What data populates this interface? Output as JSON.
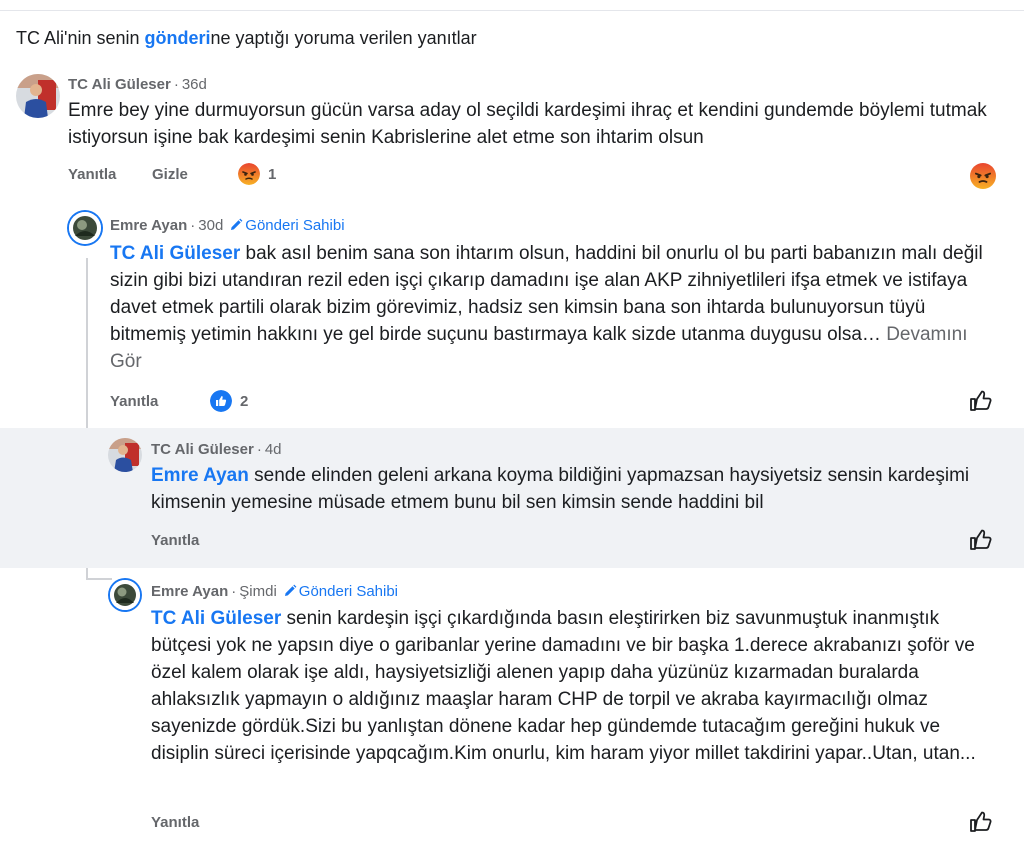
{
  "header": {
    "prefix": "TC Ali'nin senin ",
    "link": "gönderi",
    "suffix": "ne yaptığı yoruma verilen yanıtlar"
  },
  "comments": [
    {
      "author": "TC Ali Güleser",
      "time": "36d",
      "text": "Emre bey yine durmuyorsun gücün varsa aday ol seçildi kardeşimi ihraç et kendini gundemde böylemi tutmak istiyorsun işine bak kardeşimi senin Kabrislerine alet etme son ihtarim olsun",
      "reply_label": "Yanıtla",
      "hide_label": "Gizle",
      "reaction_count": "1"
    },
    {
      "author": "Emre Ayan",
      "time": "30d",
      "badge": "Gönderi Sahibi",
      "tag": "TC Ali Güleser",
      "text": " bak asıl benim sana son ihtarım olsun, haddini bil onurlu ol bu parti babanızın malı değil sizin gibi bizi utandıran rezil eden işçi çıkarıp damadını işe alan AKP zihniyetlileri ifşa etmek ve istifaya davet etmek partili olarak bizim görevimiz, hadsiz sen kimsin bana son ihtarda bulunuyorsun tüyü bitmemiş yetimin hakkını ye gel birde suçunu bastırmaya kalk sizde utanma duygusu olsa…",
      "more": " Devamını Gör",
      "reply_label": "Yanıtla",
      "reaction_count": "2"
    },
    {
      "author": "TC Ali Güleser",
      "time": "4d",
      "tag": "Emre Ayan",
      "text": " sende elinden geleni arkana koyma bildiğini yapmazsan haysiyetsiz sensin kardeşimi kimsenin yemesine müsade etmem bunu bil sen kimsin sende haddini bil",
      "reply_label": "Yanıtla"
    },
    {
      "author": "Emre Ayan",
      "time": "Şimdi",
      "badge": "Gönderi Sahibi",
      "tag": "TC Ali Güleser",
      "text": "  senin kardeşin işçi çıkardığında basın eleştirirken biz savunmuştuk inanmıştık bütçesi yok ne yapsın diye o garibanlar yerine damadını ve bir başka 1.derece akrabanızı şoför ve özel kalem olarak işe aldı, haysiyetsizliği alenen yapıp daha yüzünüz kızarmadan buralarda ahlaksızlık yapmayın o aldığınız maaşlar haram CHP de torpil ve akraba kayırmacılığı olmaz sayenizde gördük.Sizi bu yanlıştan dönene kadar hep gündemde tutacağım gereğini hukuk ve disiplin süreci içerisinde yapqcağım.Kim onurlu, kim haram yiyor millet takdirini yapar..Utan, utan...",
      "reply_label": "Yanıtla"
    }
  ],
  "meta": {
    "separator": "·"
  },
  "icons": {
    "angry": "angry-reaction-icon",
    "like": "like-reaction-icon",
    "thumb": "thumbs-up-outline-icon",
    "pencil": "pencil-icon"
  },
  "colors": {
    "accent": "#1877f2",
    "muted": "#65676b",
    "highlight": "#f0f2f5"
  }
}
